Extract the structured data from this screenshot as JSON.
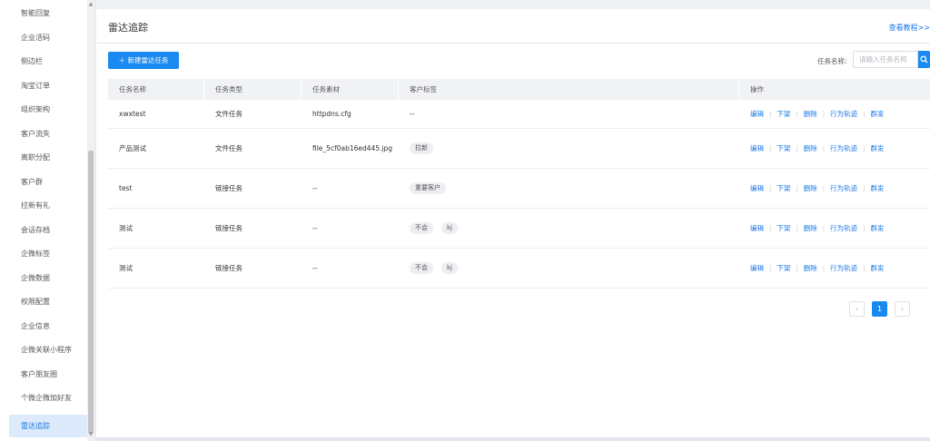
{
  "sidebar": {
    "items": [
      {
        "label": "智能回复"
      },
      {
        "label": "企业活码"
      },
      {
        "label": "侧边栏"
      },
      {
        "label": "淘宝订单"
      },
      {
        "label": "组织架构"
      },
      {
        "label": "客户流失"
      },
      {
        "label": "离职分配"
      },
      {
        "label": "客户群"
      },
      {
        "label": "拉新有礼"
      },
      {
        "label": "会话存档"
      },
      {
        "label": "企微标签"
      },
      {
        "label": "企微数据"
      },
      {
        "label": "权限配置"
      },
      {
        "label": "企业信息"
      },
      {
        "label": "企微关联小程序"
      },
      {
        "label": "客户朋友圈"
      },
      {
        "label": "个微企微加好友"
      },
      {
        "label": "雷达追踪",
        "active": true
      }
    ]
  },
  "header": {
    "title": "雷达追踪",
    "tutorial_link": "查看教程>>"
  },
  "toolbar": {
    "new_button": "新建雷达任务",
    "search_label": "任务名称:",
    "search_placeholder": "请输入任务名称",
    "search_value": ""
  },
  "table": {
    "columns": [
      "任务名称",
      "任务类型",
      "任务素材",
      "客户标签",
      "操作"
    ],
    "rows": [
      {
        "name": "xwxtest",
        "type": "文件任务",
        "material": "httpdns.cfg",
        "tags": [],
        "no_tag_text": "--"
      },
      {
        "name": "产品测试",
        "type": "文件任务",
        "material": "file_5cf0ab16ed445.jpg",
        "tags": [
          "拉新"
        ]
      },
      {
        "name": "test",
        "type": "链接任务",
        "material": "--",
        "tags": [
          "重要客户"
        ]
      },
      {
        "name": "测试",
        "type": "链接任务",
        "material": "--",
        "tags": [
          "不会",
          "kj"
        ]
      },
      {
        "name": "测试",
        "type": "链接任务",
        "material": "--",
        "tags": [
          "不会",
          "kj"
        ]
      }
    ],
    "actions": [
      "编辑",
      "下架",
      "删除",
      "行为轨迹",
      "群发"
    ]
  },
  "pagination": {
    "prev": "‹",
    "current": "1",
    "next": "›"
  },
  "colors": {
    "accent": "#1a89f0",
    "link": "#1a7ae8",
    "active_menu_bg": "#dceafb"
  }
}
